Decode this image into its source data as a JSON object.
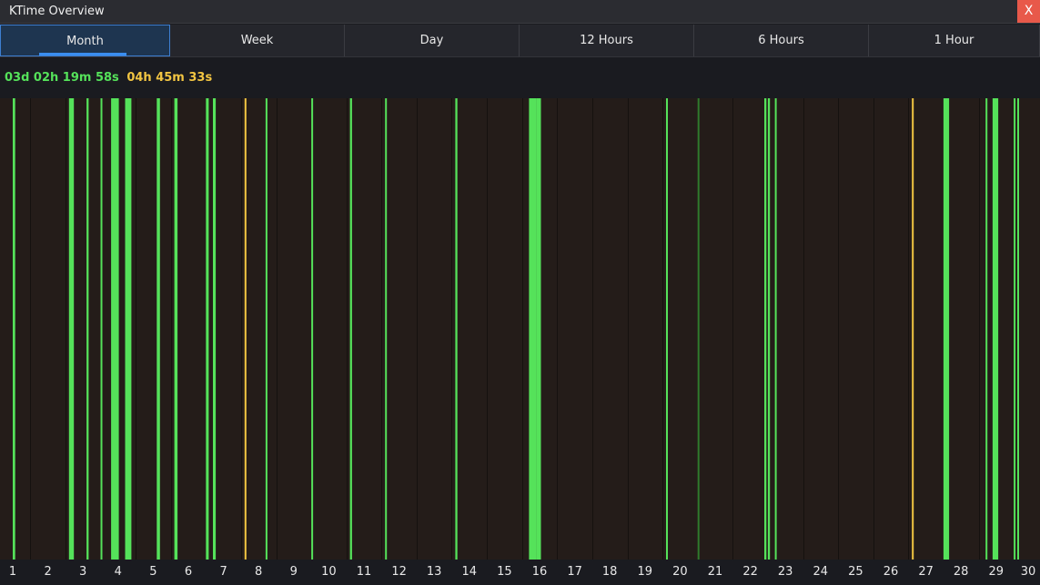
{
  "window": {
    "title": "KTime Overview",
    "close_label": "X"
  },
  "tabs": [
    {
      "label": "Month",
      "active": true
    },
    {
      "label": "Week",
      "active": false
    },
    {
      "label": "Day",
      "active": false
    },
    {
      "label": "12 Hours",
      "active": false
    },
    {
      "label": "6 Hours",
      "active": false
    },
    {
      "label": "1 Hour",
      "active": false
    }
  ],
  "summary": {
    "active_time": "03d 02h 19m 58s",
    "idle_time": "04h 45m 33s"
  },
  "colors": {
    "active": "#55e25a",
    "idle": "#f2c542",
    "faint": "#2f7a2c",
    "background": "#241c19",
    "day_divider": "#15110f"
  },
  "chart_data": {
    "type": "timeline",
    "x_unit": "day of month",
    "xlim": [
      1,
      30
    ],
    "days": [
      "1",
      "2",
      "3",
      "4",
      "5",
      "6",
      "7",
      "8",
      "9",
      "10",
      "11",
      "12",
      "13",
      "14",
      "15",
      "16",
      "17",
      "18",
      "19",
      "20",
      "21",
      "22",
      "23",
      "24",
      "25",
      "26",
      "27",
      "28",
      "29",
      "30"
    ],
    "segments": [
      {
        "day": 1.0,
        "width": 0.07,
        "status": "active"
      },
      {
        "day": 1.0,
        "width": 0.05,
        "status": "active"
      },
      {
        "day": 2.6,
        "width": 0.14,
        "status": "active"
      },
      {
        "day": 3.1,
        "width": 0.06,
        "status": "active"
      },
      {
        "day": 3.5,
        "width": 0.05,
        "status": "active"
      },
      {
        "day": 3.8,
        "width": 0.22,
        "status": "active"
      },
      {
        "day": 4.2,
        "width": 0.18,
        "status": "active"
      },
      {
        "day": 5.1,
        "width": 0.09,
        "status": "active"
      },
      {
        "day": 5.6,
        "width": 0.09,
        "status": "active"
      },
      {
        "day": 6.5,
        "width": 0.08,
        "status": "active"
      },
      {
        "day": 6.7,
        "width": 0.08,
        "status": "active"
      },
      {
        "day": 7.6,
        "width": 0.04,
        "status": "idle"
      },
      {
        "day": 8.2,
        "width": 0.05,
        "status": "active"
      },
      {
        "day": 9.5,
        "width": 0.05,
        "status": "active"
      },
      {
        "day": 10.6,
        "width": 0.06,
        "status": "active"
      },
      {
        "day": 11.6,
        "width": 0.04,
        "status": "active"
      },
      {
        "day": 13.6,
        "width": 0.06,
        "status": "active"
      },
      {
        "day": 15.7,
        "width": 0.2,
        "status": "active"
      },
      {
        "day": 15.9,
        "width": 0.14,
        "status": "active"
      },
      {
        "day": 19.6,
        "width": 0.05,
        "status": "active"
      },
      {
        "day": 20.5,
        "width": 0.04,
        "status": "faint"
      },
      {
        "day": 22.4,
        "width": 0.06,
        "status": "active"
      },
      {
        "day": 22.5,
        "width": 0.06,
        "status": "active"
      },
      {
        "day": 22.7,
        "width": 0.05,
        "status": "active"
      },
      {
        "day": 26.6,
        "width": 0.05,
        "status": "idle"
      },
      {
        "day": 27.5,
        "width": 0.16,
        "status": "active"
      },
      {
        "day": 28.7,
        "width": 0.05,
        "status": "active"
      },
      {
        "day": 28.9,
        "width": 0.16,
        "status": "active"
      },
      {
        "day": 29.5,
        "width": 0.05,
        "status": "active"
      },
      {
        "day": 29.6,
        "width": 0.05,
        "status": "active"
      }
    ]
  }
}
